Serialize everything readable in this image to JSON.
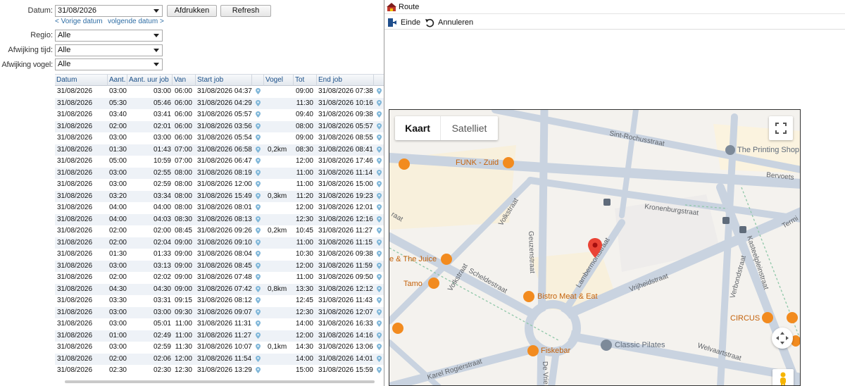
{
  "filters": {
    "datum_label": "Datum:",
    "datum_value": "31/08/2026",
    "print_button": "Afdrukken",
    "refresh_button": "Refresh",
    "prev_date": "< Vorige datum",
    "next_date": "volgende datum >",
    "regio_label": "Regio:",
    "regio_value": "Alle",
    "afwijking_tijd_label": "Afwijking tijd:",
    "afwijking_tijd_value": "Alle",
    "afwijking_vogel_label": "Afwijking vogel:",
    "afwijking_vogel_value": "Alle"
  },
  "grid": {
    "columns": [
      "Datum",
      "Aant. uur",
      "Aant. uur job",
      "Van",
      "Start job",
      "",
      "Vogel",
      "Tot",
      "End job",
      ""
    ],
    "rows": [
      [
        "31/08/2026",
        "03:00",
        "03:00",
        "06:00",
        "31/08/2026 04:37",
        "",
        "09:00",
        "31/08/2026 07:38"
      ],
      [
        "31/08/2026",
        "05:30",
        "05:46",
        "06:00",
        "31/08/2026 04:29",
        "",
        "11:30",
        "31/08/2026 10:16"
      ],
      [
        "31/08/2026",
        "03:40",
        "03:41",
        "06:00",
        "31/08/2026 05:57",
        "",
        "09:40",
        "31/08/2026 09:38"
      ],
      [
        "31/08/2026",
        "02:00",
        "02:01",
        "06:00",
        "31/08/2026 03:56",
        "",
        "08:00",
        "31/08/2026 05:57"
      ],
      [
        "31/08/2026",
        "03:00",
        "03:00",
        "06:00",
        "31/08/2026 05:54",
        "",
        "09:00",
        "31/08/2026 08:55"
      ],
      [
        "31/08/2026",
        "01:30",
        "01:43",
        "07:00",
        "31/08/2026 06:58",
        "0,2km",
        "08:30",
        "31/08/2026 08:41"
      ],
      [
        "31/08/2026",
        "05:00",
        "10:59",
        "07:00",
        "31/08/2026 06:47",
        "",
        "12:00",
        "31/08/2026 17:46"
      ],
      [
        "31/08/2026",
        "03:00",
        "02:55",
        "08:00",
        "31/08/2026 08:19",
        "",
        "11:00",
        "31/08/2026 11:14"
      ],
      [
        "31/08/2026",
        "03:00",
        "02:59",
        "08:00",
        "31/08/2026 12:00",
        "",
        "11:00",
        "31/08/2026 15:00"
      ],
      [
        "31/08/2026",
        "03:20",
        "03:34",
        "08:00",
        "31/08/2026 15:49",
        "0,3km",
        "11:20",
        "31/08/2026 19:23"
      ],
      [
        "31/08/2026",
        "04:00",
        "04:00",
        "08:00",
        "31/08/2026 08:01",
        "",
        "12:00",
        "31/08/2026 12:01"
      ],
      [
        "31/08/2026",
        "04:00",
        "04:03",
        "08:30",
        "31/08/2026 08:13",
        "",
        "12:30",
        "31/08/2026 12:16"
      ],
      [
        "31/08/2026",
        "02:00",
        "02:00",
        "08:45",
        "31/08/2026 09:26",
        "0,2km",
        "10:45",
        "31/08/2026 11:27"
      ],
      [
        "31/08/2026",
        "02:00",
        "02:04",
        "09:00",
        "31/08/2026 09:10",
        "",
        "11:00",
        "31/08/2026 11:15"
      ],
      [
        "31/08/2026",
        "01:30",
        "01:33",
        "09:00",
        "31/08/2026 08:04",
        "",
        "10:30",
        "31/08/2026 09:38"
      ],
      [
        "31/08/2026",
        "03:00",
        "03:13",
        "09:00",
        "31/08/2026 08:45",
        "",
        "12:00",
        "31/08/2026 11:59"
      ],
      [
        "31/08/2026",
        "02:00",
        "02:02",
        "09:00",
        "31/08/2026 07:48",
        "",
        "11:00",
        "31/08/2026 09:50"
      ],
      [
        "31/08/2026",
        "04:30",
        "04:30",
        "09:00",
        "31/08/2026 07:42",
        "0,8km",
        "13:30",
        "31/08/2026 12:12"
      ],
      [
        "31/08/2026",
        "03:30",
        "03:31",
        "09:15",
        "31/08/2026 08:12",
        "",
        "12:45",
        "31/08/2026 11:43"
      ],
      [
        "31/08/2026",
        "03:00",
        "03:00",
        "09:30",
        "31/08/2026 09:07",
        "",
        "12:30",
        "31/08/2026 12:07"
      ],
      [
        "31/08/2026",
        "03:00",
        "05:01",
        "11:00",
        "31/08/2026 11:31",
        "",
        "14:00",
        "31/08/2026 16:33"
      ],
      [
        "31/08/2026",
        "01:00",
        "02:49",
        "11:00",
        "31/08/2026 11:27",
        "",
        "12:00",
        "31/08/2026 14:16"
      ],
      [
        "31/08/2026",
        "03:00",
        "02:59",
        "11:30",
        "31/08/2026 10:07",
        "0,1km",
        "14:30",
        "31/08/2026 13:06"
      ],
      [
        "31/08/2026",
        "02:00",
        "02:06",
        "12:00",
        "31/08/2026 11:54",
        "",
        "14:00",
        "31/08/2026 14:01"
      ],
      [
        "31/08/2026",
        "02:30",
        "02:30",
        "12:30",
        "31/08/2026 13:29",
        "",
        "15:00",
        "31/08/2026 15:59"
      ]
    ]
  },
  "route": {
    "title": "Route",
    "einde": "Einde",
    "annuleren": "Annuleren"
  },
  "map": {
    "tab_map": "Kaart",
    "tab_satellite": "Satelliet",
    "streets": {
      "sint_rochus": "Sint-Rochusstraat",
      "bervoets": "Bervoets",
      "kronenburg": "Kronenburgstraat",
      "volk_upper": "Volkstraat",
      "volk_lower": "Volkstraat",
      "geuzen": "Geuzenstraat",
      "lambermont": "Lambermontstraat",
      "schelde": "Scheldestraat",
      "vrijheid": "Vrijheidstraat",
      "verbond": "Verbondstraat",
      "kasteelplein": "Kasteelpleinstraat",
      "karel": "Karel Rogierstraat",
      "welvaart": "Welvaartstraat",
      "de_vrie": "De Vrie",
      "termi": "Termi",
      "left_straat": "raat"
    },
    "pois": {
      "printing": "The Printing Shop",
      "funk": "FUNK - Zuid",
      "juice": "e & The Juice",
      "tamo": "Tamo",
      "bistro": "Bistro Meat & Eat",
      "fiskebar": "Fiskebar",
      "pilates": "Classic Pilates",
      "circus": "CIRCUS"
    },
    "accent_red": "#ea4335",
    "poi_orange": "#f28b1f",
    "poi_gray": "#7d8a99"
  }
}
